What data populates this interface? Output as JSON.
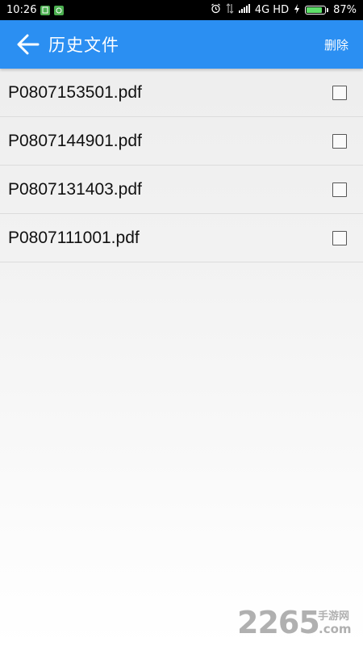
{
  "status_bar": {
    "time": "10:26",
    "network": "4G HD",
    "battery": "87%",
    "battery_level": 0.87,
    "icons": [
      "sim-icon",
      "app-notification-icon",
      "alarm-icon",
      "data-transfer-icon",
      "signal-icon",
      "charging-icon",
      "battery-icon"
    ]
  },
  "app_bar": {
    "title": "历史文件",
    "delete_label": "删除",
    "back_icon": "arrow-left-icon",
    "background_color": "#2b8ff2"
  },
  "files": [
    {
      "name": "P0807153501.pdf",
      "checked": false
    },
    {
      "name": "P0807144901.pdf",
      "checked": false
    },
    {
      "name": "P0807131403.pdf",
      "checked": false
    },
    {
      "name": "P0807111001.pdf",
      "checked": false
    }
  ],
  "watermark": {
    "number": "2265",
    "brand": "手游网",
    "domain": ".com"
  }
}
